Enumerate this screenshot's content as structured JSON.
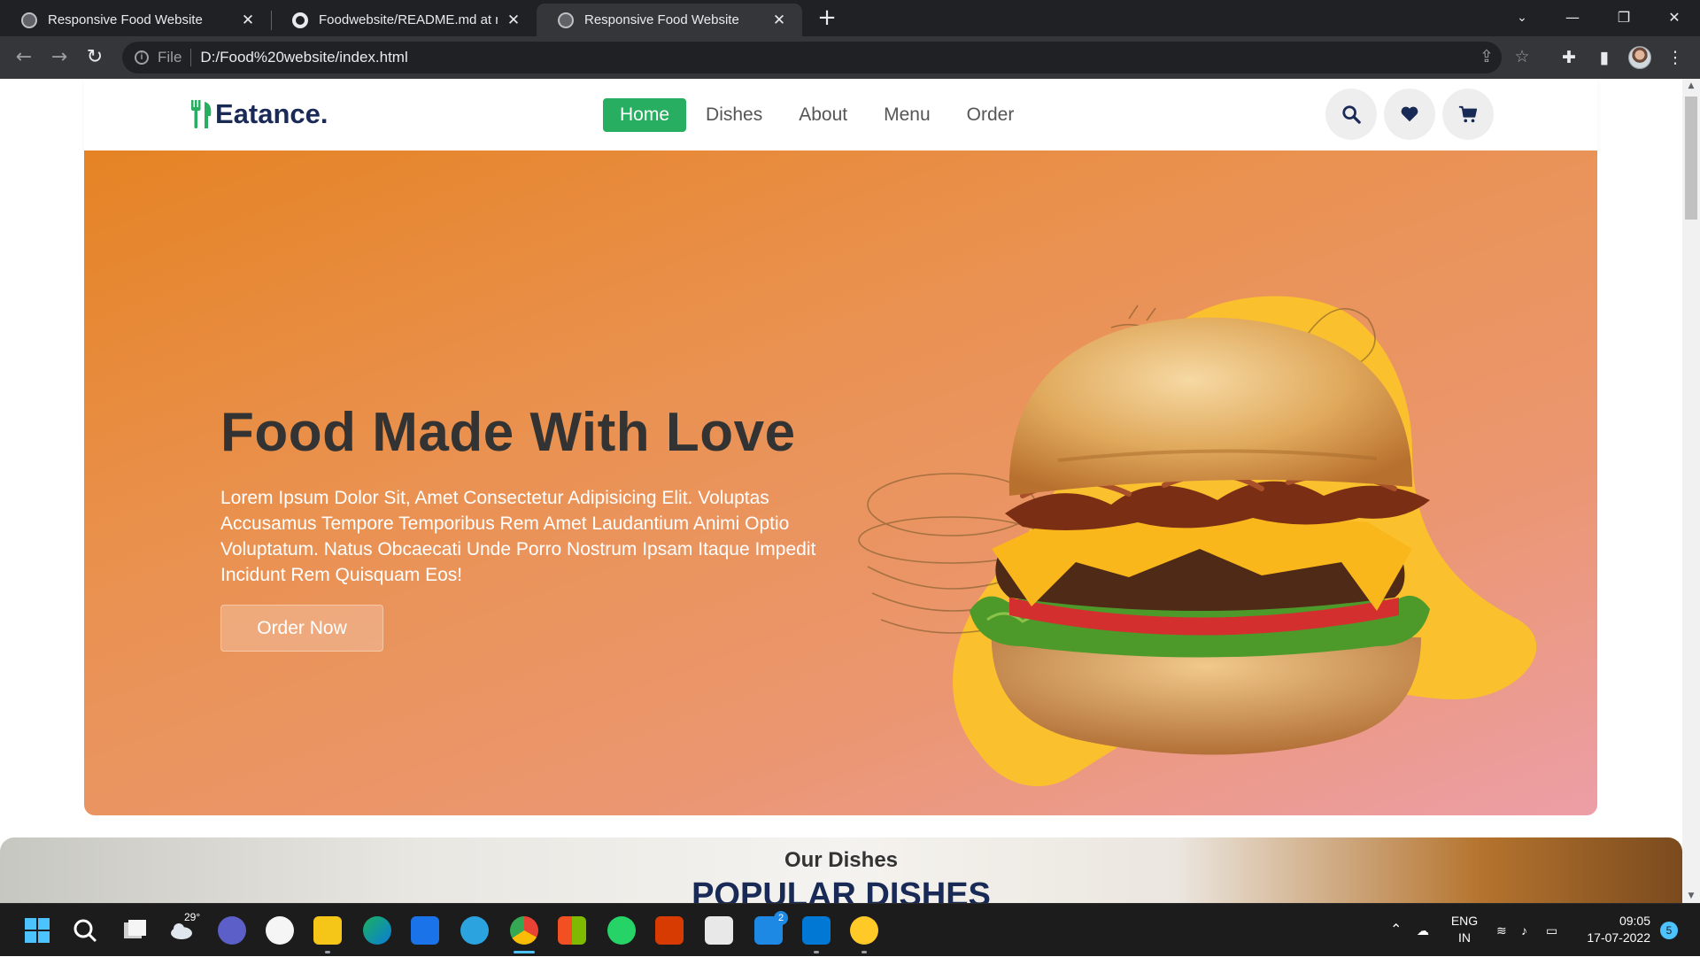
{
  "browser": {
    "tabs": [
      {
        "title": "Responsive Food Website",
        "active": false,
        "icon": "globe-icon"
      },
      {
        "title": "Foodwebsite/README.md at mai",
        "active": false,
        "icon": "github-icon"
      },
      {
        "title": "Responsive Food Website",
        "active": true,
        "icon": "globe-icon"
      }
    ],
    "scheme_label": "File",
    "url": "D:/Food%20website/index.html"
  },
  "site": {
    "logo_text": "Eatance.",
    "nav": [
      {
        "label": "Home",
        "active": true
      },
      {
        "label": "Dishes",
        "active": false
      },
      {
        "label": "About",
        "active": false
      },
      {
        "label": "Menu",
        "active": false
      },
      {
        "label": "Order",
        "active": false
      }
    ],
    "header_icons": [
      "search-icon",
      "heart-icon",
      "cart-icon"
    ],
    "hero": {
      "title": "Food Made With Love",
      "text": "Lorem Ipsum Dolor Sit, Amet Consectetur Adipisicing Elit. Voluptas Accusamus Tempore Temporibus Rem Amet Laudantium Animi Optio Voluptatum. Natus Obcaecati Unde Porro Nostrum Ipsam Itaque Impedit Incidunt Rem Quisquam Eos!",
      "button": "Order Now"
    },
    "dishes": {
      "subheading": "Our Dishes",
      "heading": "POPULAR DISHES"
    },
    "colors": {
      "accent": "#27ae60",
      "heading": "#192a56",
      "hero_start": "#e58324",
      "hero_end": "#ec9ea6",
      "blob": "#fbc02d"
    }
  },
  "taskbar": {
    "weather": "29°",
    "telegram_badge": "2",
    "language": "ENG",
    "region": "IN",
    "time": "09:05",
    "date": "17-07-2022",
    "notifications": "5"
  }
}
